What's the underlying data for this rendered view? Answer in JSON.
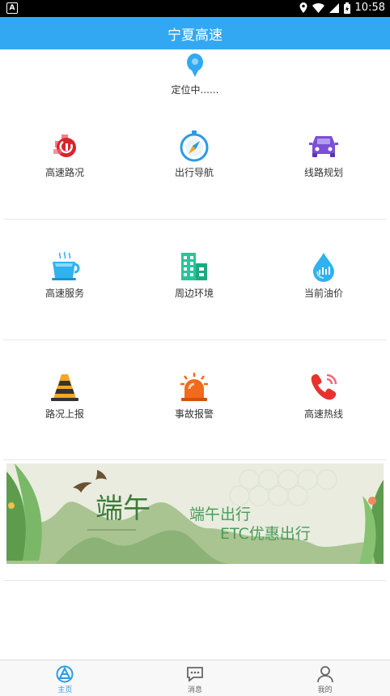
{
  "status_bar": {
    "time": "10:58",
    "notification_icon": "A"
  },
  "header": {
    "title": "宁夏高速"
  },
  "location": {
    "status": "定位中......"
  },
  "grid": [
    [
      {
        "label": "高速路况",
        "icon": "road-condition-icon",
        "color": "#e8322e"
      },
      {
        "label": "出行导航",
        "icon": "compass-icon",
        "color": "#2b9ae8"
      },
      {
        "label": "线路规划",
        "icon": "car-icon",
        "color": "#7b4fd6"
      }
    ],
    [
      {
        "label": "高速服务",
        "icon": "cup-icon",
        "color": "#2fb2ef"
      },
      {
        "label": "周边环境",
        "icon": "buildings-icon",
        "color": "#26c59a"
      },
      {
        "label": "当前油价",
        "icon": "oil-drop-icon",
        "color": "#2fb2ef"
      }
    ],
    [
      {
        "label": "路况上报",
        "icon": "traffic-cone-icon",
        "color": "#f5a623"
      },
      {
        "label": "事故报警",
        "icon": "alarm-light-icon",
        "color": "#f26a1b"
      },
      {
        "label": "高速热线",
        "icon": "phone-icon",
        "color": "#e8322e"
      }
    ]
  ],
  "banner": {
    "title": "端午",
    "line1": "端午出行",
    "line2": "ETC优惠出行"
  },
  "tabs": [
    {
      "label": "主页",
      "icon": "home-icon",
      "active": true
    },
    {
      "label": "消息",
      "icon": "message-icon",
      "active": false
    },
    {
      "label": "我的",
      "icon": "profile-icon",
      "active": false
    }
  ],
  "colors": {
    "primary": "#32a8f3",
    "tab_active": "#2b9ae8",
    "tab_inactive": "#666666"
  }
}
